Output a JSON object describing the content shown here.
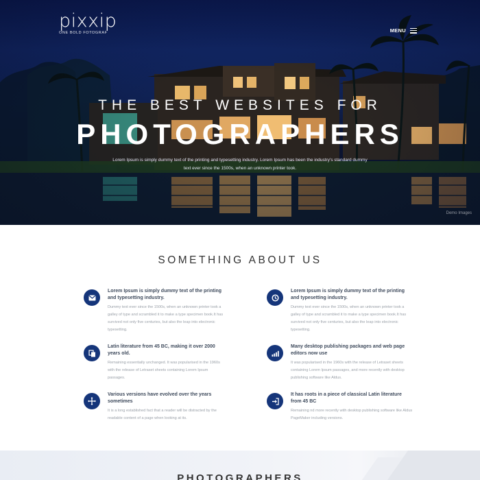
{
  "header": {
    "logo_name": "pixxip",
    "logo_tagline": "ONE BOLD FOTOGRAF",
    "menu_label": "MENU"
  },
  "hero": {
    "kicker": "THE BEST WEBSITES FOR",
    "headline": "PHOTOGRAPHERS",
    "lead": "Lorem Ipsum is simply dummy text of the printing and typesetting industry. Lorem Ipsum has been the industry's standard dummy text ever since the 1500s, when an unknown printer took.",
    "credit": "Demo Images"
  },
  "about": {
    "title": "SOMETHING ABOUT US",
    "features": [
      {
        "icon": "envelope-icon",
        "title": "Lorem Ipsum is simply dummy text of the printing and typesetting industry.",
        "text": "Dummy text ever since the 1500s, when an unknown printer took a galley of type and scrambled it to make a type specimen book.It has survived not only five centuries, but also the leap into electronic typesetting."
      },
      {
        "icon": "clock-icon",
        "title": "Lorem Ipsum is simply dummy text of the printing and typesetting industry.",
        "text": "Dummy text ever since the 1500s, when an unknown printer took a galley of type and scrambled it to make a type specimen book.It has survived not only five centuries, but also the leap into electronic typesetting."
      },
      {
        "icon": "copy-icon",
        "title": "Latin literature from 45 BC, making it over 2000 years old.",
        "text": "Remaining essentially unchanged. It was popularised in the 1960s with the release of Letraset sheets containing Lorem Ipsum passages."
      },
      {
        "icon": "signal-icon",
        "title": "Many desktop publishing packages and web page editors now use",
        "text": "It was popularised in the 1960s with the release of Letraset sheets containing Lorem Ipsum passages, and more recently with desktop publishing software like Aldus."
      },
      {
        "icon": "move-icon",
        "title": "Various versions have evolved over the years sometimes",
        "text": "It is a long established fact that a reader will be distracted by the readable content of a page when looking at its."
      },
      {
        "icon": "sign-in-icon",
        "title": "It has roots in a piece of classical Latin literature from 45 BC",
        "text": "Remaining nd more recently with desktop publishing software like Aldus PageMaker including versions."
      }
    ]
  },
  "next_section": {
    "title": "PHOTOGRAPHERS"
  },
  "colors": {
    "accent": "#15357a",
    "hero_sky": "#112663",
    "heading": "#333333",
    "body_text": "#9aa0a8"
  }
}
